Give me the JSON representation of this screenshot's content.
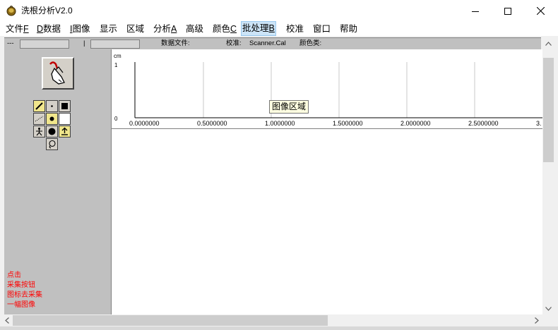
{
  "window": {
    "title": "洗根分析V2.0",
    "minimize_icon": "minimize-icon",
    "maximize_icon": "maximize-icon",
    "close_icon": "close-icon"
  },
  "menu": {
    "items": [
      {
        "label": "文件",
        "accel": "F"
      },
      {
        "label": "",
        "accel": "D",
        "suffix": "数据"
      },
      {
        "label": "",
        "accel": "I",
        "suffix": "图像"
      },
      {
        "label": "显示",
        "accel": ""
      },
      {
        "label": "区域",
        "accel": ""
      },
      {
        "label": "分析",
        "accel": "A"
      },
      {
        "label": "高级",
        "accel": ""
      },
      {
        "label": "颜色",
        "accel": "C"
      },
      {
        "label": "批处理",
        "accel": "B"
      },
      {
        "label": "校准",
        "accel": ""
      },
      {
        "label": "窗口",
        "accel": ""
      },
      {
        "label": "帮助",
        "accel": ""
      }
    ],
    "active_index": 8
  },
  "status_strip": {
    "dash": "---",
    "sep": "|",
    "data_file_label": "数据文件:",
    "calibration_label": "校准:",
    "calibration_value": "Scanner.Cal",
    "color_class_label": "颜色类:"
  },
  "plot": {
    "y_unit": "cm",
    "y_max_label": "1",
    "y_min_label": "0",
    "x_ticks": [
      "0.0000000",
      "0.5000000",
      "1.0000000",
      "1.5000000",
      "2.0000000",
      "2.5000000",
      "3."
    ],
    "tooltip": "图像区域"
  },
  "left_panel": {
    "capture_icon": "hand-pointer-icon",
    "tools": [
      "pencil-icon",
      "dot-small-icon",
      "square-black-icon",
      "line-dotted-icon",
      "dot-large-icon",
      "square-white-icon",
      "figure-icon",
      "circle-filled-icon",
      "upload-icon",
      "lasso-icon"
    ],
    "hint": [
      "点击",
      "采集按钮",
      "图标去采集",
      "一幅图像"
    ]
  },
  "colors": {
    "hint_text": "#ff0000",
    "panel_gray": "#c0c0c0",
    "menu_active_bg": "#cce4f7"
  }
}
